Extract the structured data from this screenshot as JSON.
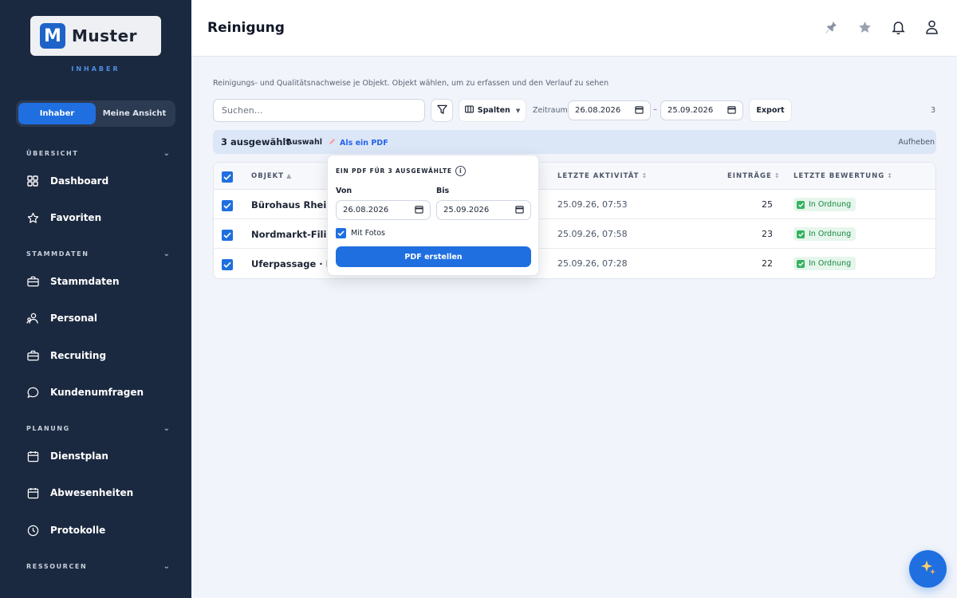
{
  "sidebar": {
    "logo_text": "Muster",
    "role_caption": "INHABER",
    "toggle": {
      "active": "Inhaber",
      "other": "Meine Ansicht"
    },
    "sections": {
      "uebersicht": "ÜBERSICHT",
      "stammdaten": "STAMMDATEN",
      "planung": "PLANUNG",
      "ressourcen": "RESSOURCEN"
    },
    "items": [
      {
        "label": "Dashboard",
        "icon": "grid-icon"
      },
      {
        "label": "Favoriten",
        "icon": "star-icon"
      },
      {
        "label": "Stammdaten",
        "icon": "briefcase-icon"
      },
      {
        "label": "Personal",
        "icon": "people-icon"
      },
      {
        "label": "Recruiting",
        "icon": "briefcase-icon"
      },
      {
        "label": "Kundenumfragen",
        "icon": "chat-icon"
      },
      {
        "label": "Dienstplan",
        "icon": "calendar-icon"
      },
      {
        "label": "Abwesenheiten",
        "icon": "calendar-icon"
      },
      {
        "label": "Protokolle",
        "icon": "clock-icon"
      }
    ]
  },
  "header": {
    "title": "Reinigung",
    "icons": [
      "pin-icon",
      "star-icon",
      "bell-icon",
      "user-icon"
    ]
  },
  "main": {
    "description": "Reinigungs- und Qualitätsnachweise je Objekt. Objekt wählen, um zu erfassen und den Verlauf zu sehen",
    "search_placeholder": "Suchen...",
    "columns_label": "Spalten",
    "zeitraum_label": "Zeitraum:",
    "date_from": "26.08.2026",
    "date_to": "25.09.2026",
    "date_sep": "–",
    "export_label": "Export",
    "count": "3"
  },
  "selection": {
    "count_label": "3 ausgewählt",
    "auswahl_label": "Auswahl",
    "pdf_label": "Als ein PDF",
    "clear_label": "Aufheben"
  },
  "table": {
    "headers": {
      "objekt": "OBJEKT",
      "objekt_sort": "▲",
      "letzte_aktivitaet": "LETZTE AKTIVITÄT",
      "eintraege": "EINTRÄGE",
      "letzte_bewertung": "LETZTE BEWERTUNG",
      "sort_icon": "↕"
    },
    "rows": [
      {
        "objekt": "Bürohaus Rheinall",
        "aktivitaet": "25.09.26, 07:53",
        "eintraege": "25",
        "bewertung": "In Ordnung"
      },
      {
        "objekt": "Nordmarkt-Filiale",
        "aktivitaet": "25.09.26, 07:58",
        "eintraege": "23",
        "bewertung": "In Ordnung"
      },
      {
        "objekt": "Uferpassage · Emp",
        "aktivitaet": "25.09.26, 07:28",
        "eintraege": "22",
        "bewertung": "In Ordnung"
      }
    ]
  },
  "popover": {
    "title": "EIN PDF FÜR 3 AUSGEWÄHLTE",
    "info_glyph": "i",
    "von_label": "Von",
    "bis_label": "Bis",
    "von_value": "26.08.2026",
    "bis_value": "25.09.2026",
    "fotos_label": "Mit Fotos",
    "button_label": "PDF erstellen"
  },
  "colors": {
    "sidebar_bg": "#1b2940",
    "accent": "#1f6fe0",
    "status_green": "#16883e"
  }
}
